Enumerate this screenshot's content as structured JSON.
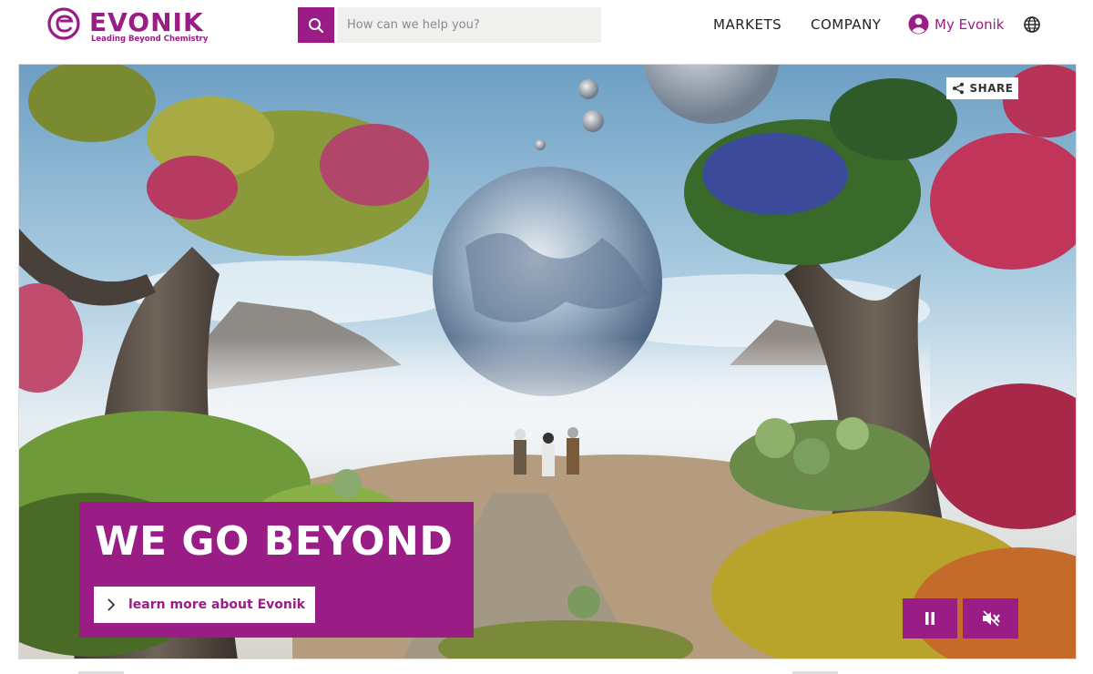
{
  "header": {
    "logo_word": "EVONIK",
    "logo_tagline": "Leading Beyond Chemistry",
    "search_placeholder": "How can we help you?",
    "nav": {
      "markets": "MARKETS",
      "company": "COMPANY",
      "my_evonik": "My Evonik"
    }
  },
  "hero": {
    "share_label": "SHARE",
    "headline": "WE GO BEYOND",
    "cta_label": "learn more about Evonik"
  },
  "colors": {
    "brand": "#991D85",
    "search_bg": "#f0f0ee"
  },
  "icons": {
    "search": "search-icon",
    "user": "user-icon",
    "globe": "globe-icon",
    "share": "share-icon",
    "chevron": "chevron-right-icon",
    "pause": "pause-icon",
    "mute": "speaker-muted-icon"
  }
}
